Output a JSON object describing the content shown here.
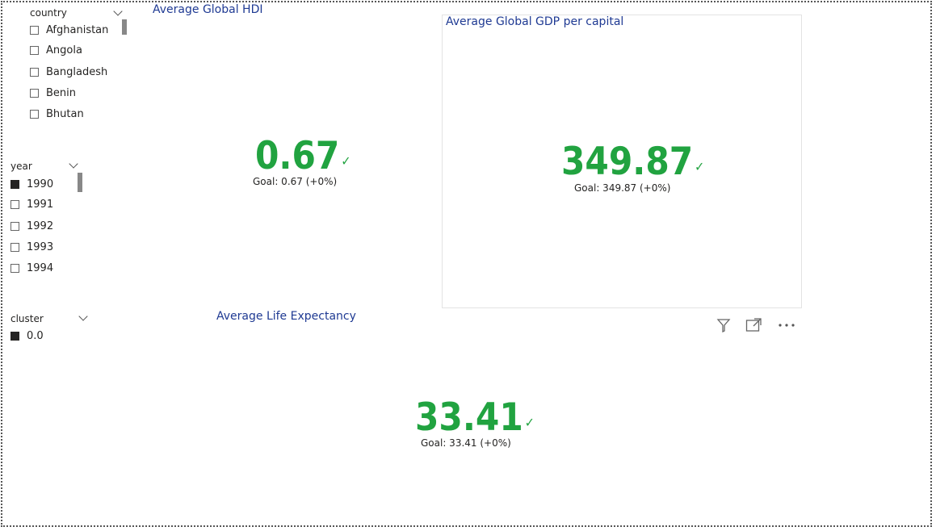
{
  "slicers": {
    "country": {
      "title": "country",
      "items": [
        "Afghanistan",
        "Angola",
        "Bangladesh",
        "Benin",
        "Bhutan"
      ]
    },
    "year": {
      "title": "year",
      "items": [
        "1990",
        "1991",
        "1992",
        "1993",
        "1994"
      ],
      "selected": "1990"
    },
    "cluster": {
      "title": "cluster",
      "items": [
        "0.0"
      ],
      "selected": "0.0"
    }
  },
  "cards": {
    "hdi": {
      "title": "Average Global HDI",
      "value": "0.67",
      "goal": "Goal: 0.67 (+0%)"
    },
    "gdp": {
      "title": "Average Global GDP per capital",
      "value": "349.87",
      "goal": "Goal: 349.87 (+0%)"
    },
    "life": {
      "title": "Average Life Expectancy",
      "value": "33.41",
      "goal": "Goal: 33.41 (+0%)"
    }
  },
  "visual_header_icons": [
    "filter-icon",
    "focus-mode-icon",
    "more-options-icon"
  ],
  "colors": {
    "kpi_green": "#21a340",
    "title_blue": "#1f3a93",
    "checked": "#252423"
  }
}
